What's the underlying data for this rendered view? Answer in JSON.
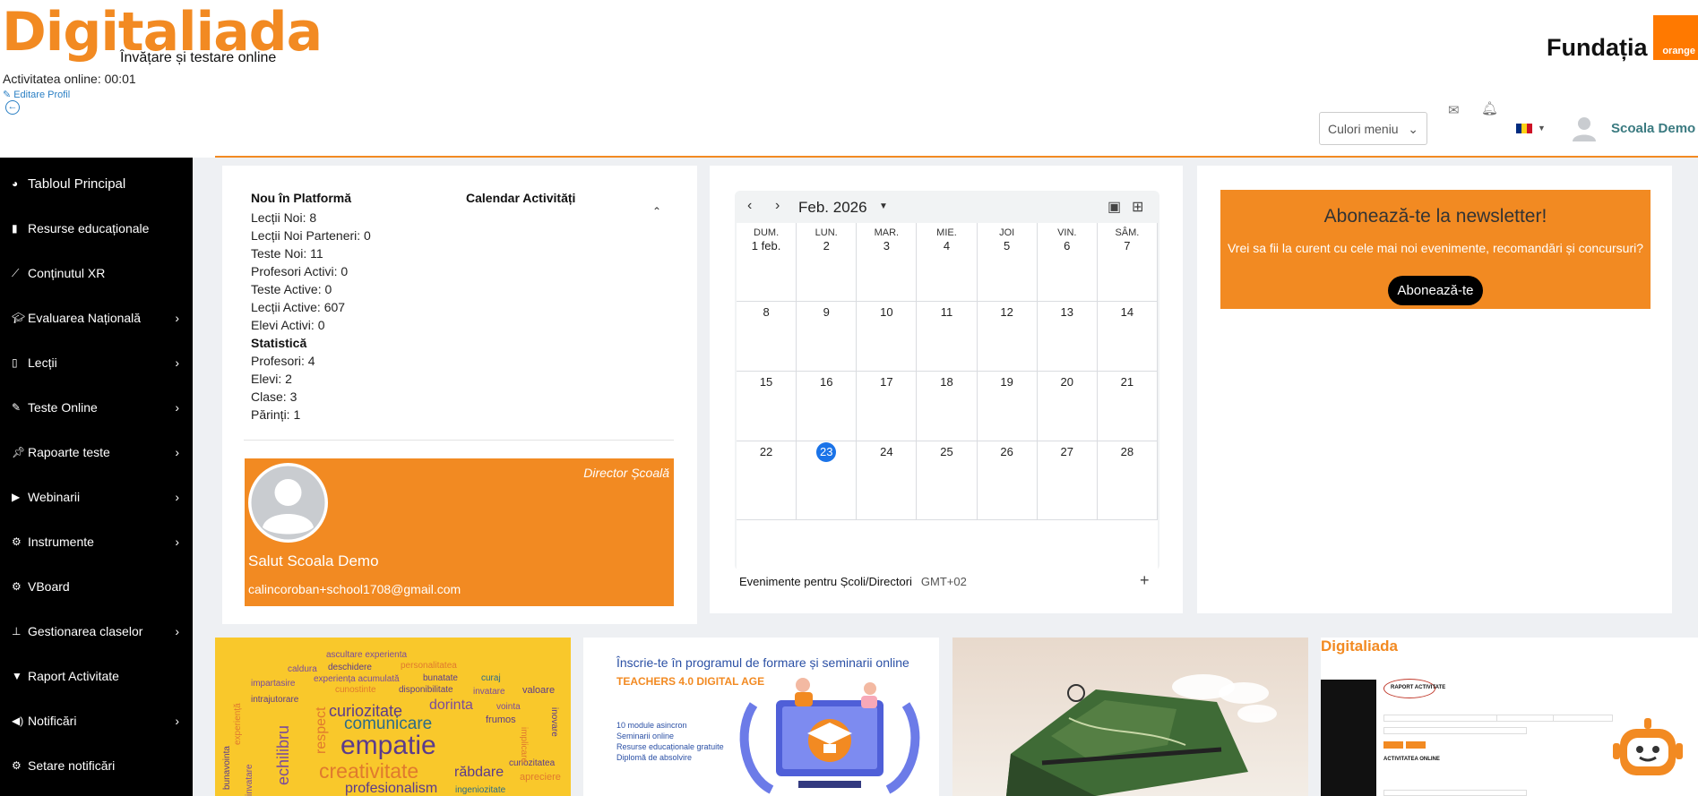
{
  "header": {
    "logo": "Digitaliada",
    "tagline": "Învățare și testare online",
    "activity": "Activitatea online: 00:01",
    "edit_profile": "Editare Profil",
    "partner_name": "Fundația",
    "partner_badge": "orange",
    "menu_colors_label": "Culori meniu",
    "user_name": "Scoala Demo",
    "accent_color": "#f28a22"
  },
  "sidebar": {
    "items": [
      {
        "label": "Tabloul Principal",
        "icon": "dashboard-icon",
        "chevron": false
      },
      {
        "label": "Resurse educaționale",
        "icon": "book-icon",
        "chevron": false
      },
      {
        "label": "Conținutul XR",
        "icon": "magic-wand-icon",
        "chevron": false
      },
      {
        "label": "Evaluarea Națională",
        "icon": "graduation-cap-icon",
        "chevron": true
      },
      {
        "label": "Lecții",
        "icon": "file-icon",
        "chevron": true
      },
      {
        "label": "Teste Online",
        "icon": "edit-icon",
        "chevron": true
      },
      {
        "label": "Rapoarte teste",
        "icon": "pin-icon",
        "chevron": true
      },
      {
        "label": "Webinarii",
        "icon": "play-icon",
        "chevron": true
      },
      {
        "label": "Instrumente",
        "icon": "cogs-icon",
        "chevron": true
      },
      {
        "label": "VBoard",
        "icon": "gear-icon",
        "chevron": false
      },
      {
        "label": "Gestionarea claselor",
        "icon": "sitemap-icon",
        "chevron": true
      },
      {
        "label": "Raport Activitate",
        "icon": "filter-icon",
        "chevron": false
      },
      {
        "label": "Notificări",
        "icon": "volume-icon",
        "chevron": true
      },
      {
        "label": "Setare notificări",
        "icon": "gear-icon",
        "chevron": false
      }
    ]
  },
  "platform": {
    "title": "Nou în Platformă",
    "calendar_title": "Calendar Activități",
    "lines": [
      "Lecții Noi: 8",
      "Lecții Noi Parteneri: 0",
      "Teste Noi: 11",
      "Profesori Activi: 0",
      "Teste Active: 0",
      "Lecții Active: 607",
      "Elevi Activi: 0"
    ],
    "stats_title": "Statistică",
    "stats": [
      "Profesori: 4",
      "Elevi: 2",
      "Clase: 3",
      "Părinți: 1"
    ]
  },
  "profile": {
    "role": "Director Școală",
    "greeting": "Salut Scoala Demo",
    "email": "calincoroban+school1708@gmail.com"
  },
  "calendar": {
    "month": "Feb. 2026",
    "weekdays": [
      "DUM.",
      "LUN.",
      "MAR.",
      "MIE.",
      "JOI",
      "VIN.",
      "SÂM."
    ],
    "weeks": [
      [
        "1 feb.",
        "2",
        "3",
        "4",
        "5",
        "6",
        "7"
      ],
      [
        "8",
        "9",
        "10",
        "11",
        "12",
        "13",
        "14"
      ],
      [
        "15",
        "16",
        "17",
        "18",
        "19",
        "20",
        "21"
      ],
      [
        "22",
        "23",
        "24",
        "25",
        "26",
        "27",
        "28"
      ]
    ],
    "today": "23",
    "footer_label": "Evenimente pentru Școli/Directori",
    "timezone": "GMT+02",
    "today_color": "#1a73e8"
  },
  "newsletter": {
    "title": "Abonează-te la newsletter!",
    "text": "Vrei sa fii la curent cu cele mai noi evenimente, recomandări și concursuri?",
    "button": "Abonează-te"
  },
  "tiles": {
    "words": [
      "ascultare experienta",
      "personalitatea",
      "caldura",
      "deschidere",
      "bunatate",
      "curaj",
      "impartasire",
      "experiența acumulată",
      "cunostinte",
      "disponibilitate",
      "invatare",
      "valoare",
      "intrajutorare",
      "curiozitate",
      "dorinta",
      "vointa",
      "comunicare",
      "frumos",
      "empatie",
      "creativitate",
      "răbdare",
      "apreciere",
      "profesionalism",
      "ingeniozitate",
      "echilibru",
      "respect",
      "bunavointa",
      "experiență",
      "invatare",
      "curiozitatea",
      "implicare",
      "inovare"
    ],
    "teachers_title": "Înscrie-te în programul de formare și seminarii online",
    "teachers_sub": "TEACHERS 4.0 DIGITAL AGE",
    "teachers_list": [
      "10 module asincron",
      "Seminarii online",
      "Resurse educaționale gratuite",
      "Diplomă de absolvire"
    ],
    "mini_logo": "Digitaliada",
    "mini_report": "RAPORT ACTIVITATE",
    "mini_online": "ACTIVITATEA ONLINE"
  }
}
